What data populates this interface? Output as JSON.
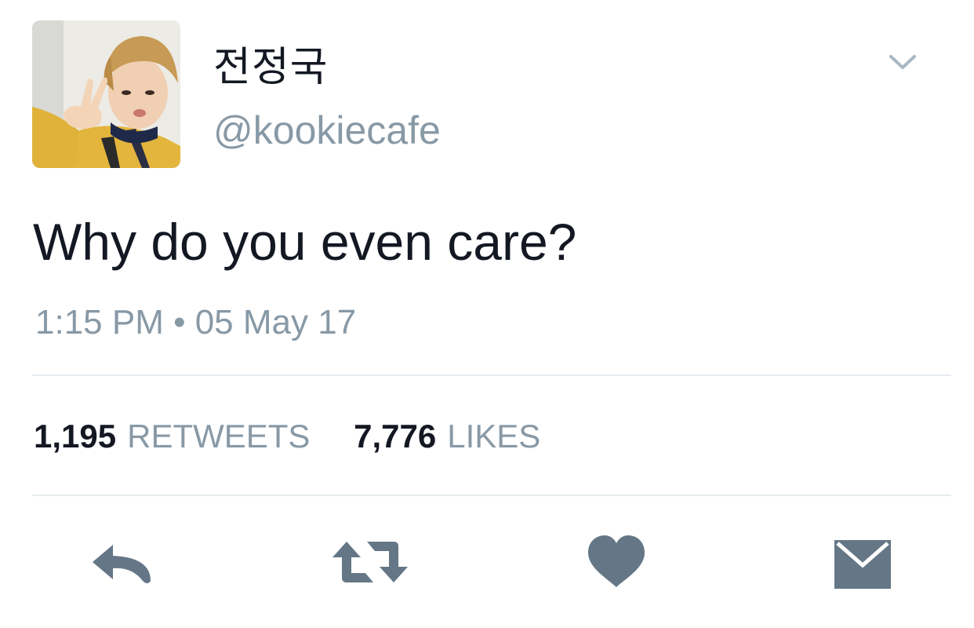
{
  "user": {
    "display_name": "전정국",
    "handle": "@kookiecafe"
  },
  "tweet": {
    "text": "Why do you even care?",
    "timestamp": "1:15 PM • 05 May 17"
  },
  "stats": {
    "retweets_count": "1,195",
    "retweets_label": "RETWEETS",
    "likes_count": "7,776",
    "likes_label": "LIKES"
  },
  "icons": {
    "caret": "chevron-down-icon",
    "reply": "reply-icon",
    "retweet": "retweet-icon",
    "like": "heart-icon",
    "dm": "envelope-icon"
  },
  "colors": {
    "text": "#141823",
    "secondary": "#8899a6",
    "action_icon": "#657786",
    "divider": "#e6ecf0"
  }
}
